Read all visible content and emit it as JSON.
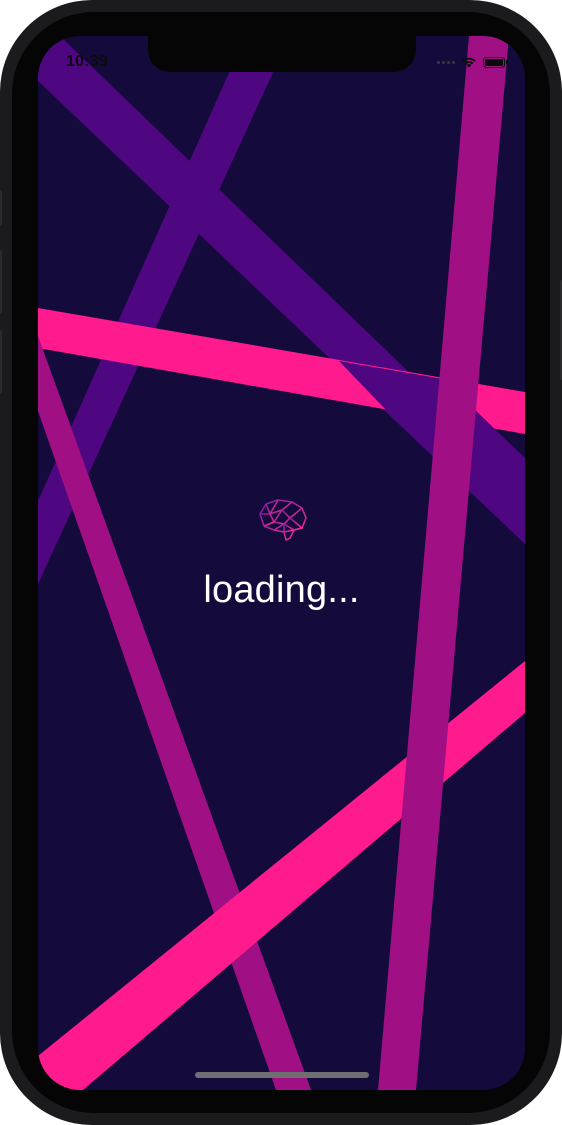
{
  "status_bar": {
    "time": "10:39",
    "icons": [
      "signal-dots-icon",
      "wifi-icon",
      "battery-icon"
    ]
  },
  "main": {
    "loading_text": "loading...",
    "logo_icon": "brain-icon"
  },
  "colors": {
    "background": "#140b3c",
    "stripe_purple": "#4e0681",
    "stripe_magenta": "#a10f85",
    "stripe_pink": "#ff1b8d",
    "text": "#ffffff"
  }
}
